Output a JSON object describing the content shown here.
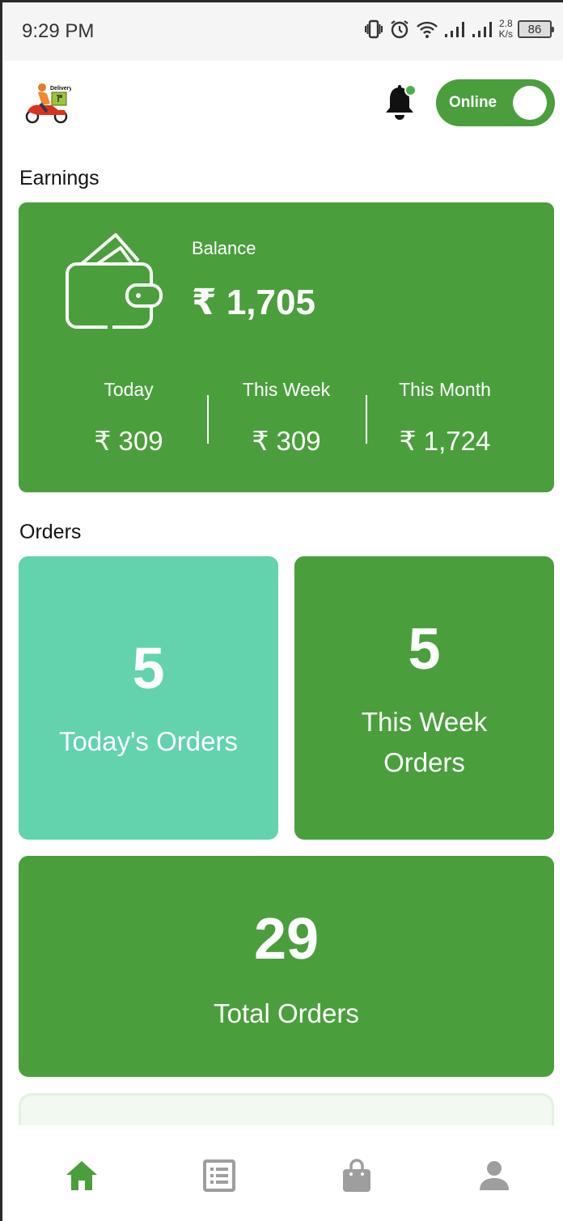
{
  "status_bar": {
    "time": "9:29 PM",
    "net_speed_value": "2.8",
    "net_speed_unit": "K/s",
    "battery": "86"
  },
  "header": {
    "logo_text": "Delivery",
    "online_label": "Online",
    "online": true,
    "notification_dot": true
  },
  "earnings": {
    "title": "Earnings",
    "balance_label": "Balance",
    "balance_value": "₹ 1,705",
    "stats": [
      {
        "label": "Today",
        "value": "₹ 309"
      },
      {
        "label": "This Week",
        "value": "₹ 309"
      },
      {
        "label": "This Month",
        "value": "₹ 1,724"
      }
    ]
  },
  "orders": {
    "title": "Orders",
    "today": {
      "value": "5",
      "label": "Today's Orders"
    },
    "week": {
      "value": "5",
      "label_line1": "This Week",
      "label_line2": "Orders"
    },
    "total": {
      "value": "29",
      "label": "Total Orders"
    }
  },
  "bottom_nav": {
    "items": [
      "home-icon",
      "list-icon",
      "bag-icon",
      "person-icon"
    ],
    "active": "home-icon"
  },
  "colors": {
    "primary_green": "#4a9f3c",
    "teal_card": "#63d3ad",
    "nav_inactive": "#9e9e9e"
  }
}
